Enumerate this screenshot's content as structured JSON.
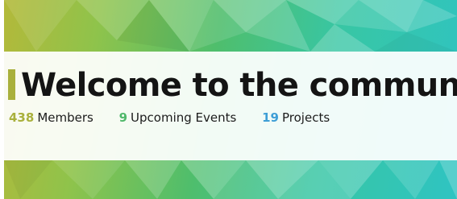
{
  "banner": {
    "headline": "Welcome to the community",
    "stats": [
      {
        "value": "438",
        "label": "Members",
        "color": "#a9b03c"
      },
      {
        "value": "9",
        "label": "Upcoming Events",
        "color": "#4fb86a"
      },
      {
        "value": "19",
        "label": "Projects",
        "color": "#3e9ed6"
      }
    ],
    "colors": {
      "accent": "#a9b03c",
      "gradient_start": "#b3b93a",
      "gradient_end": "#2fc4c2"
    }
  }
}
